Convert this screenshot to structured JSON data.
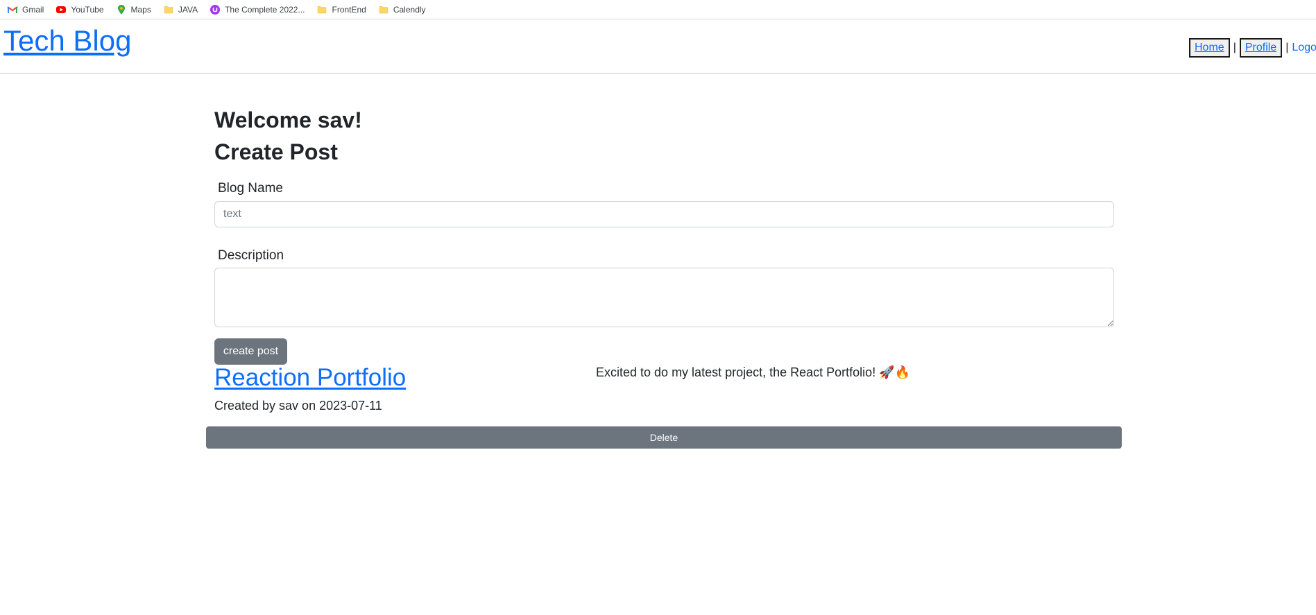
{
  "bookmarks": [
    {
      "label": "Gmail",
      "icon": "gmail-icon"
    },
    {
      "label": "YouTube",
      "icon": "youtube-icon"
    },
    {
      "label": "Maps",
      "icon": "maps-icon"
    },
    {
      "label": "JAVA",
      "icon": "folder-icon"
    },
    {
      "label": "The Complete 2022...",
      "icon": "udemy-icon"
    },
    {
      "label": "FrontEnd",
      "icon": "folder-icon"
    },
    {
      "label": "Calendly",
      "icon": "folder-icon"
    }
  ],
  "header": {
    "title": "Tech Blog",
    "nav": {
      "home": "Home",
      "separator": "|",
      "profile": "Profile",
      "logout": "Logout"
    }
  },
  "main": {
    "welcome": "Welcome sav!",
    "create_heading": "Create Post",
    "form": {
      "blog_name_label": "Blog Name",
      "blog_name_placeholder": "text",
      "description_label": "Description",
      "submit_label": "create post"
    },
    "post": {
      "title": "Reaction Portfolio",
      "description": "Excited to do my latest project, the React Portfolio! 🚀🔥",
      "meta": "Created by sav on 2023-07-11",
      "delete_label": "Delete"
    }
  },
  "colors": {
    "link": "#0d6efd",
    "button": "#6c757d",
    "text": "#212529"
  }
}
